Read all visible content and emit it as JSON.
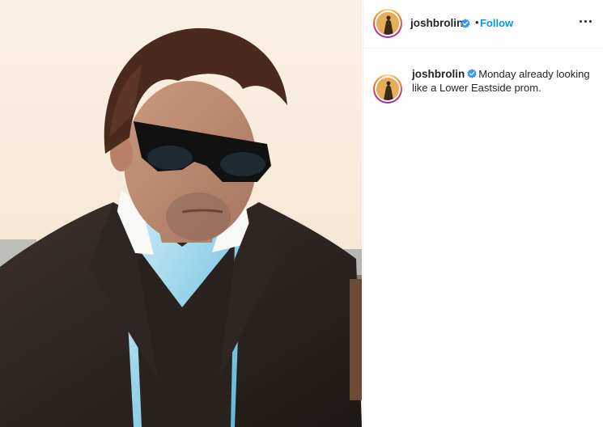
{
  "post": {
    "image_alt": "Man with slicked-back hair wearing dark sunglasses, a light blue shirt and a dark suit, looking down",
    "account": {
      "username": "joshbrolin",
      "verified": true,
      "follow_label": "Follow",
      "separator": "•"
    },
    "more_icon": "more-options-icon",
    "caption": {
      "username": "joshbrolin",
      "text": "Monday already looking like a Lower Eastside prom."
    }
  },
  "colors": {
    "link_blue": "#0095f6",
    "verified_blue": "#3897f0",
    "text": "#262626",
    "divider": "#efefef"
  }
}
